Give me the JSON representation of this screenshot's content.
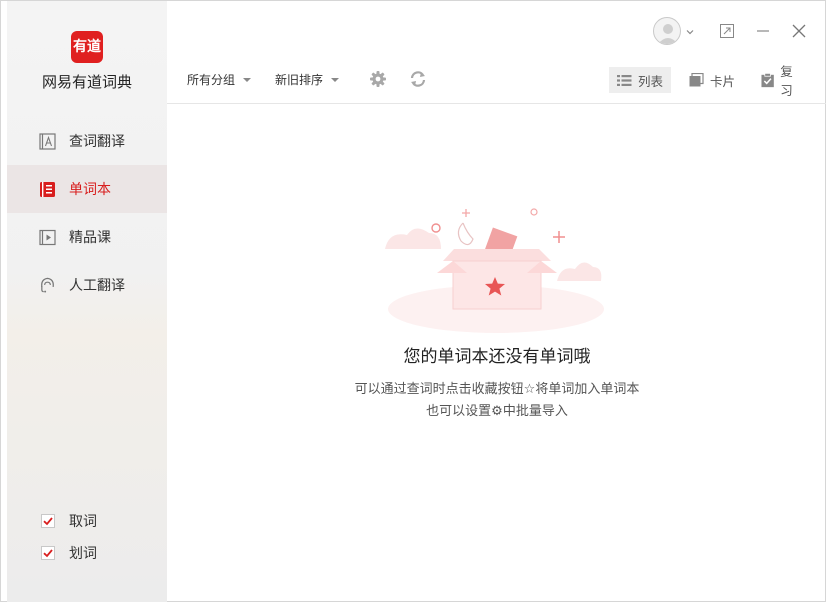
{
  "app": {
    "logo_text": "有道",
    "name": "网易有道词典"
  },
  "sidebar": {
    "items": [
      {
        "label": "查词翻译",
        "icon": "dictionary-icon",
        "active": false
      },
      {
        "label": "单词本",
        "icon": "wordbook-icon",
        "active": true
      },
      {
        "label": "精品课",
        "icon": "course-play-icon",
        "active": false
      },
      {
        "label": "人工翻译",
        "icon": "headset-icon",
        "active": false
      }
    ],
    "checks": [
      {
        "label": "取词",
        "checked": true
      },
      {
        "label": "划词",
        "checked": true
      }
    ]
  },
  "toolbar": {
    "group_filter": "所有分组",
    "sort_order": "新旧排序",
    "views": [
      {
        "label": "列表",
        "icon": "list-icon",
        "active": true
      },
      {
        "label": "卡片",
        "icon": "card-icon",
        "active": false
      },
      {
        "label": "复习",
        "icon": "review-clipboard-icon",
        "active": false
      }
    ]
  },
  "empty_state": {
    "title": "您的单词本还没有单词哦",
    "line1": "可以通过查词时点击收藏按钮☆将单词加入单词本",
    "line2": "也可以设置⚙中批量导入"
  },
  "colors": {
    "accent": "#d81e1e",
    "logo_bg": "#e02020",
    "sidebar_active_bg": "#ebe5e5"
  }
}
